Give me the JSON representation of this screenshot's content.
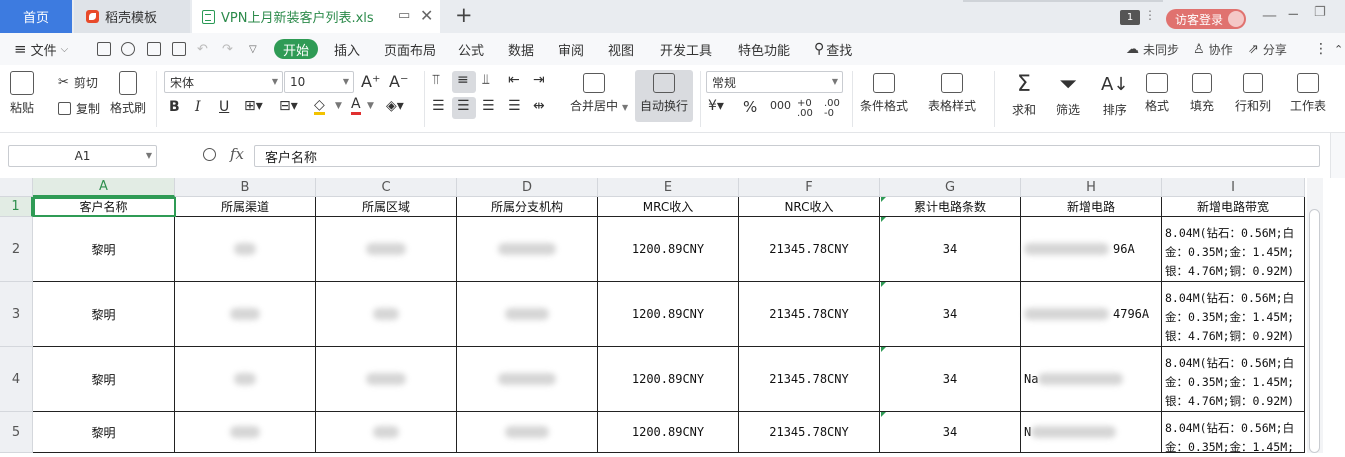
{
  "tabs": {
    "home": "首页",
    "template": "稻壳模板",
    "file": "VPN上月新装客户列表.xls"
  },
  "titlebar": {
    "window_count": "1",
    "login": "访客登录"
  },
  "menu": {
    "file": "文件",
    "items": [
      "开始",
      "插入",
      "页面布局",
      "公式",
      "数据",
      "审阅",
      "视图",
      "开发工具",
      "特色功能"
    ],
    "search": "查找",
    "right": [
      "未同步",
      "协作",
      "分享"
    ]
  },
  "ribbon": {
    "paste": "粘贴",
    "cut": "剪切",
    "copy": "复制",
    "format_painter": "格式刷",
    "font_name": "宋体",
    "font_size": "10",
    "merge": "合并居中",
    "wrap": "自动换行",
    "number_format": "常规",
    "cond_format": "条件格式",
    "table_style": "表格样式",
    "sum": "求和",
    "filter": "筛选",
    "sort": "排序",
    "format": "格式",
    "fill": "填充",
    "rowcol": "行和列",
    "sheet": "工作表"
  },
  "formula": {
    "cell_ref": "A1",
    "content": "客户名称"
  },
  "grid": {
    "columns": [
      "A",
      "B",
      "C",
      "D",
      "E",
      "F",
      "G",
      "H",
      "I"
    ],
    "rows": [
      "1",
      "2",
      "3",
      "4",
      "5"
    ],
    "header": [
      "客户名称",
      "所属渠道",
      "所属区域",
      "所属分支机构",
      "MRC收入",
      "NRC收入",
      "累计电路条数",
      "新增电路",
      "新增电路带宽"
    ],
    "data": [
      {
        "name": "黎明",
        "mrc": "1200.89CNY",
        "nrc": "21345.78CNY",
        "count": "34",
        "circuit": "96A",
        "bw": "8.04M(钻石：0.56M;白\n金：0.35M;金：1.45M;\n银：4.76M;铜：0.92M)"
      },
      {
        "name": "黎明",
        "mrc": "1200.89CNY",
        "nrc": "21345.78CNY",
        "count": "34",
        "circuit": "4796A",
        "bw": "8.04M(钻石：0.56M;白\n金：0.35M;金：1.45M;\n银：4.76M;铜：0.92M)"
      },
      {
        "name": "黎明",
        "mrc": "1200.89CNY",
        "nrc": "21345.78CNY",
        "count": "34",
        "circuit": "Na",
        "bw": "8.04M(钻石：0.56M;白\n金：0.35M;金：1.45M;\n银：4.76M;铜：0.92M)"
      },
      {
        "name": "黎明",
        "mrc": "1200.89CNY",
        "nrc": "21345.78CNY",
        "count": "34",
        "circuit": "N",
        "bw": "8.04M(钻石：0.56M;白\n金：0.35M;金：1.45M;"
      }
    ]
  }
}
